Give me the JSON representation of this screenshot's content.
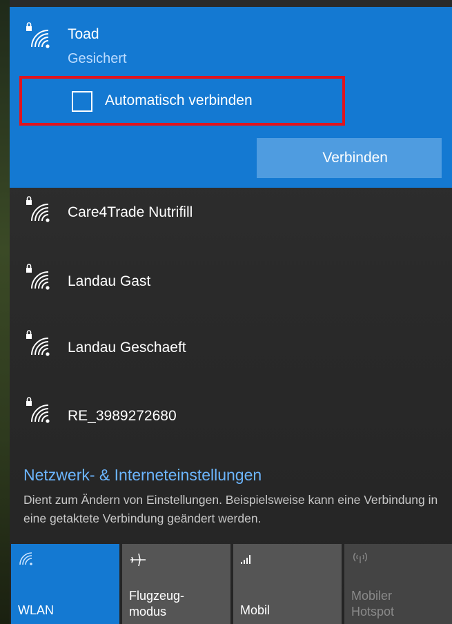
{
  "selected_network": {
    "name": "Toad",
    "status": "Gesichert",
    "auto_connect_label": "Automatisch verbinden",
    "auto_connect_checked": false,
    "connect_label": "Verbinden"
  },
  "networks": [
    {
      "name": "Care4Trade Nutrifill"
    },
    {
      "name": "Landau Gast"
    },
    {
      "name": "Landau Geschaeft"
    },
    {
      "name": "RE_3989272680"
    }
  ],
  "settings": {
    "link": "Netzwerk- & Interneteinstellungen",
    "description": "Dient zum Ändern von Einstellungen. Beispielsweise kann eine Verbindung in eine getaktete Verbindung geändert werden."
  },
  "quick_actions": [
    {
      "label": "WLAN",
      "icon": "wifi-icon",
      "active": true,
      "enabled": true
    },
    {
      "label": "Flugzeug-\nmodus",
      "icon": "airplane-icon",
      "active": false,
      "enabled": true
    },
    {
      "label": "Mobil",
      "icon": "cellular-signal-icon",
      "active": false,
      "enabled": true
    },
    {
      "label": "Mobiler\nHotspot",
      "icon": "mobile-hotspot-icon",
      "active": false,
      "enabled": false
    }
  ],
  "colors": {
    "accent": "#1479d2",
    "button": "#4f9ce0",
    "highlight_border": "#e0141e",
    "link": "#6cb6ff"
  }
}
